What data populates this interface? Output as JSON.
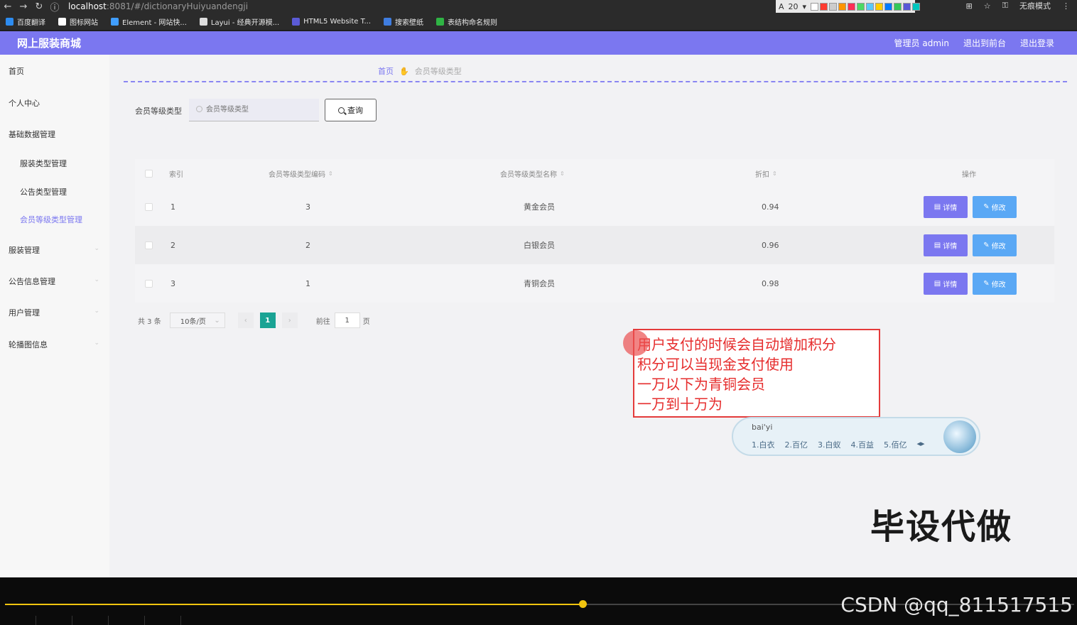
{
  "browser": {
    "url_host": "localhost",
    "url_rest": ":8081/#/dictionaryHuiyuandengji",
    "zoom_label": "20",
    "incognito": "无痕模式",
    "swatches": [
      "#ffffff",
      "#ff3b30",
      "#cccccc",
      "#ff9500",
      "#ff2d55",
      "#4cd964",
      "#5ac8fa",
      "#ffcc00",
      "#007aff",
      "#34c759",
      "#5856d6",
      "#00c7be"
    ],
    "bookmarks": [
      {
        "label": "百度翻译",
        "color": "#2d8cf0"
      },
      {
        "label": "图标网站",
        "color": "#ffffff"
      },
      {
        "label": "Element - 网站快...",
        "color": "#409eff"
      },
      {
        "label": "Layui - 经典开源模...",
        "color": "#dddddd"
      },
      {
        "label": "HTML5 Website T...",
        "color": "#5b5bd6"
      },
      {
        "label": "搜索壁纸",
        "color": "#3f7de0"
      },
      {
        "label": "表结构命名规则",
        "color": "#2fb344"
      }
    ]
  },
  "header": {
    "brand": "网上服装商城",
    "admin": "管理员 admin",
    "to_front": "退出到前台",
    "logout": "退出登录"
  },
  "sidebar": {
    "items": [
      {
        "label": "首页"
      },
      {
        "label": "个人中心"
      },
      {
        "label": "基础数据管理"
      },
      {
        "label": "服装类型管理"
      },
      {
        "label": "公告类型管理"
      },
      {
        "label": "会员等级类型管理"
      },
      {
        "label": "服装管理"
      },
      {
        "label": "公告信息管理"
      },
      {
        "label": "用户管理"
      },
      {
        "label": "轮播图信息"
      }
    ]
  },
  "breadcrumb": {
    "home": "首页",
    "current": "会员等级类型"
  },
  "search": {
    "label": "会员等级类型",
    "placeholder": "会员等级类型",
    "button": "查询"
  },
  "table": {
    "headers": [
      "索引",
      "会员等级类型编码",
      "会员等级类型名称",
      "折扣",
      "操作"
    ],
    "rows": [
      {
        "index": "1",
        "code": "3",
        "name": "黄金会员",
        "discount": "0.94"
      },
      {
        "index": "2",
        "code": "2",
        "name": "白银会员",
        "discount": "0.96"
      },
      {
        "index": "3",
        "code": "1",
        "name": "青铜会员",
        "discount": "0.98"
      }
    ],
    "detail_label": "详情",
    "edit_label": "修改"
  },
  "pagination": {
    "total": "共 3 条",
    "page_size": "10条/页",
    "current_page": "1",
    "goto_label": "前往",
    "goto_value": "1",
    "page_unit": "页"
  },
  "annotation": {
    "lines": [
      "用户支付的时候会自动增加积分",
      "积分可以当现金支付使用",
      "一万以下为青铜会员",
      "一万到十万为"
    ]
  },
  "ime": {
    "composition": "bai'yi",
    "candidates": [
      "1.白衣",
      "2.百亿",
      "3.白蚁",
      "4.百益",
      "5.佰亿"
    ]
  },
  "watermark": "毕设代做",
  "video": {
    "progress": 0.54,
    "credit": "CSDN @qq_811517515"
  }
}
